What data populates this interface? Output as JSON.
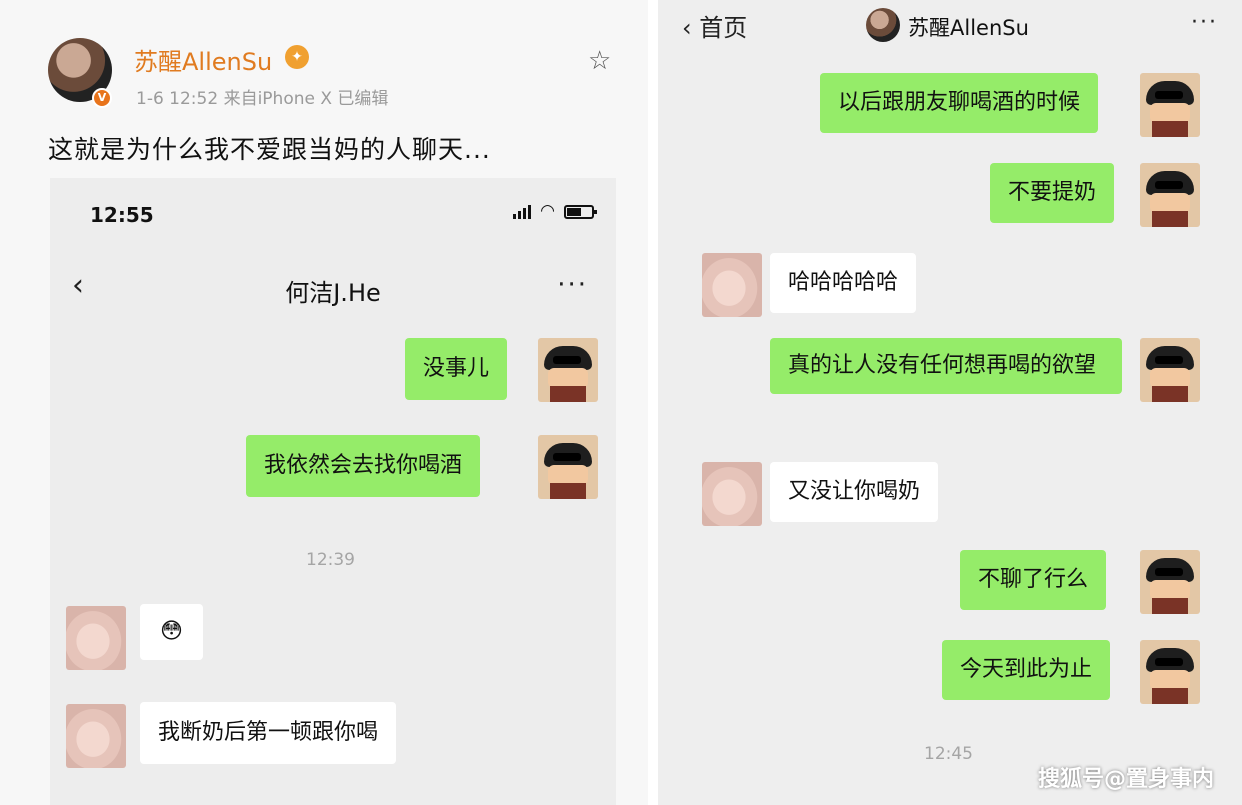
{
  "post": {
    "author": "苏醒AllenSu",
    "meta": "1-6 12:52  来自iPhone X  已编辑",
    "text": "这就是为什么我不爱跟当妈的人聊天..."
  },
  "left_chat": {
    "status_time": "12:55",
    "title": "何洁J.He",
    "more": "···",
    "time_sep": "12:39",
    "emoji": "😳",
    "messages": [
      {
        "from": "me",
        "text": "没事儿"
      },
      {
        "from": "me",
        "text": "我依然会去找你喝酒"
      },
      {
        "from": "other",
        "text": "我断奶后第一顿跟你喝"
      }
    ]
  },
  "right_chat": {
    "back_label": "首页",
    "title": "苏醒AllenSu",
    "more": "···",
    "time_sep": "12:45",
    "messages": [
      {
        "from": "me",
        "text": "以后跟朋友聊喝酒的时候"
      },
      {
        "from": "me",
        "text": "不要提奶"
      },
      {
        "from": "other",
        "text": "哈哈哈哈哈"
      },
      {
        "from": "me",
        "text": "真的让人没有任何想再喝的欲望"
      },
      {
        "from": "other",
        "text": "又没让你喝奶"
      },
      {
        "from": "me",
        "text": "不聊了行么"
      },
      {
        "from": "me",
        "text": "今天到此为止"
      }
    ]
  },
  "watermark": "搜狐号@置身事内",
  "colors": {
    "me_bubble": "#95ec69",
    "other_bubble": "#ffffff",
    "author": "#e07b20"
  }
}
